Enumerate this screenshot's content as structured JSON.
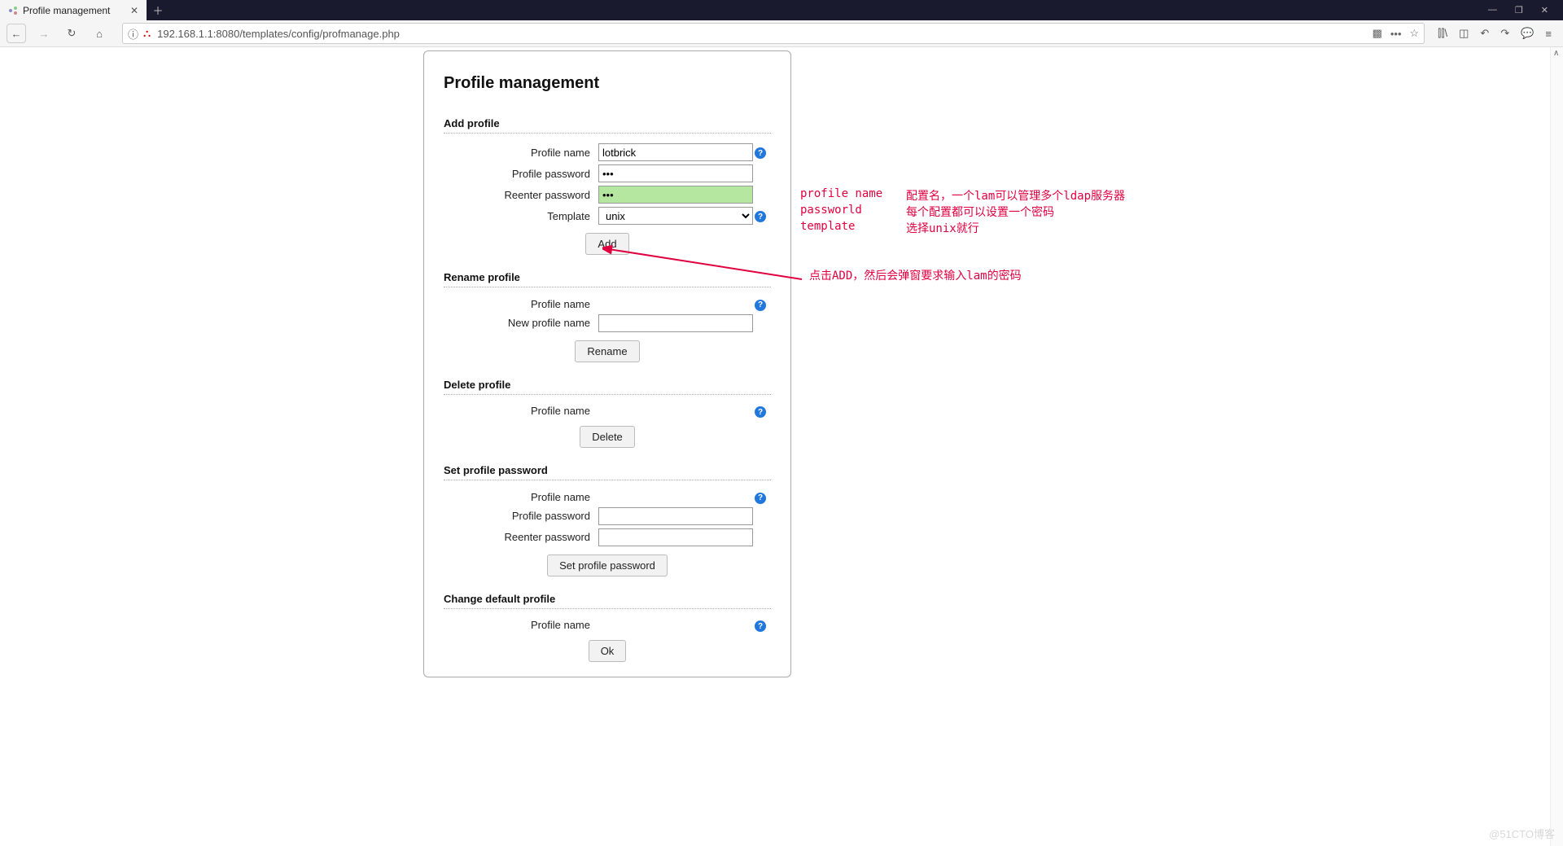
{
  "browser": {
    "tab_title": "Profile management",
    "url": "192.168.1.1:8080/templates/config/profmanage.php"
  },
  "page": {
    "title": "Profile management",
    "sections": {
      "add": {
        "legend": "Add profile",
        "profile_name_label": "Profile name",
        "profile_name_value": "lotbrick",
        "profile_password_label": "Profile password",
        "profile_password_value": "•••",
        "reenter_password_label": "Reenter password",
        "reenter_password_value": "•••",
        "template_label": "Template",
        "template_value": "unix",
        "button": "Add"
      },
      "rename": {
        "legend": "Rename profile",
        "profile_name_label": "Profile name",
        "new_profile_name_label": "New profile name",
        "button": "Rename"
      },
      "delete": {
        "legend": "Delete profile",
        "profile_name_label": "Profile name",
        "button": "Delete"
      },
      "setpw": {
        "legend": "Set profile password",
        "profile_name_label": "Profile name",
        "profile_password_label": "Profile password",
        "reenter_password_label": "Reenter password",
        "button": "Set profile password"
      },
      "default": {
        "legend": "Change default profile",
        "profile_name_label": "Profile name",
        "button": "Ok"
      }
    }
  },
  "annotations": {
    "table": [
      [
        "profile name",
        "配置名，一个lam可以管理多个ldap服务器"
      ],
      [
        "passworld",
        "每个配置都可以设置一个密码"
      ],
      [
        "template",
        "选择unix就行"
      ]
    ],
    "arrow_text": "点击ADD，然后会弹窗要求输入lam的密码"
  },
  "watermark": "@51CTO博客"
}
